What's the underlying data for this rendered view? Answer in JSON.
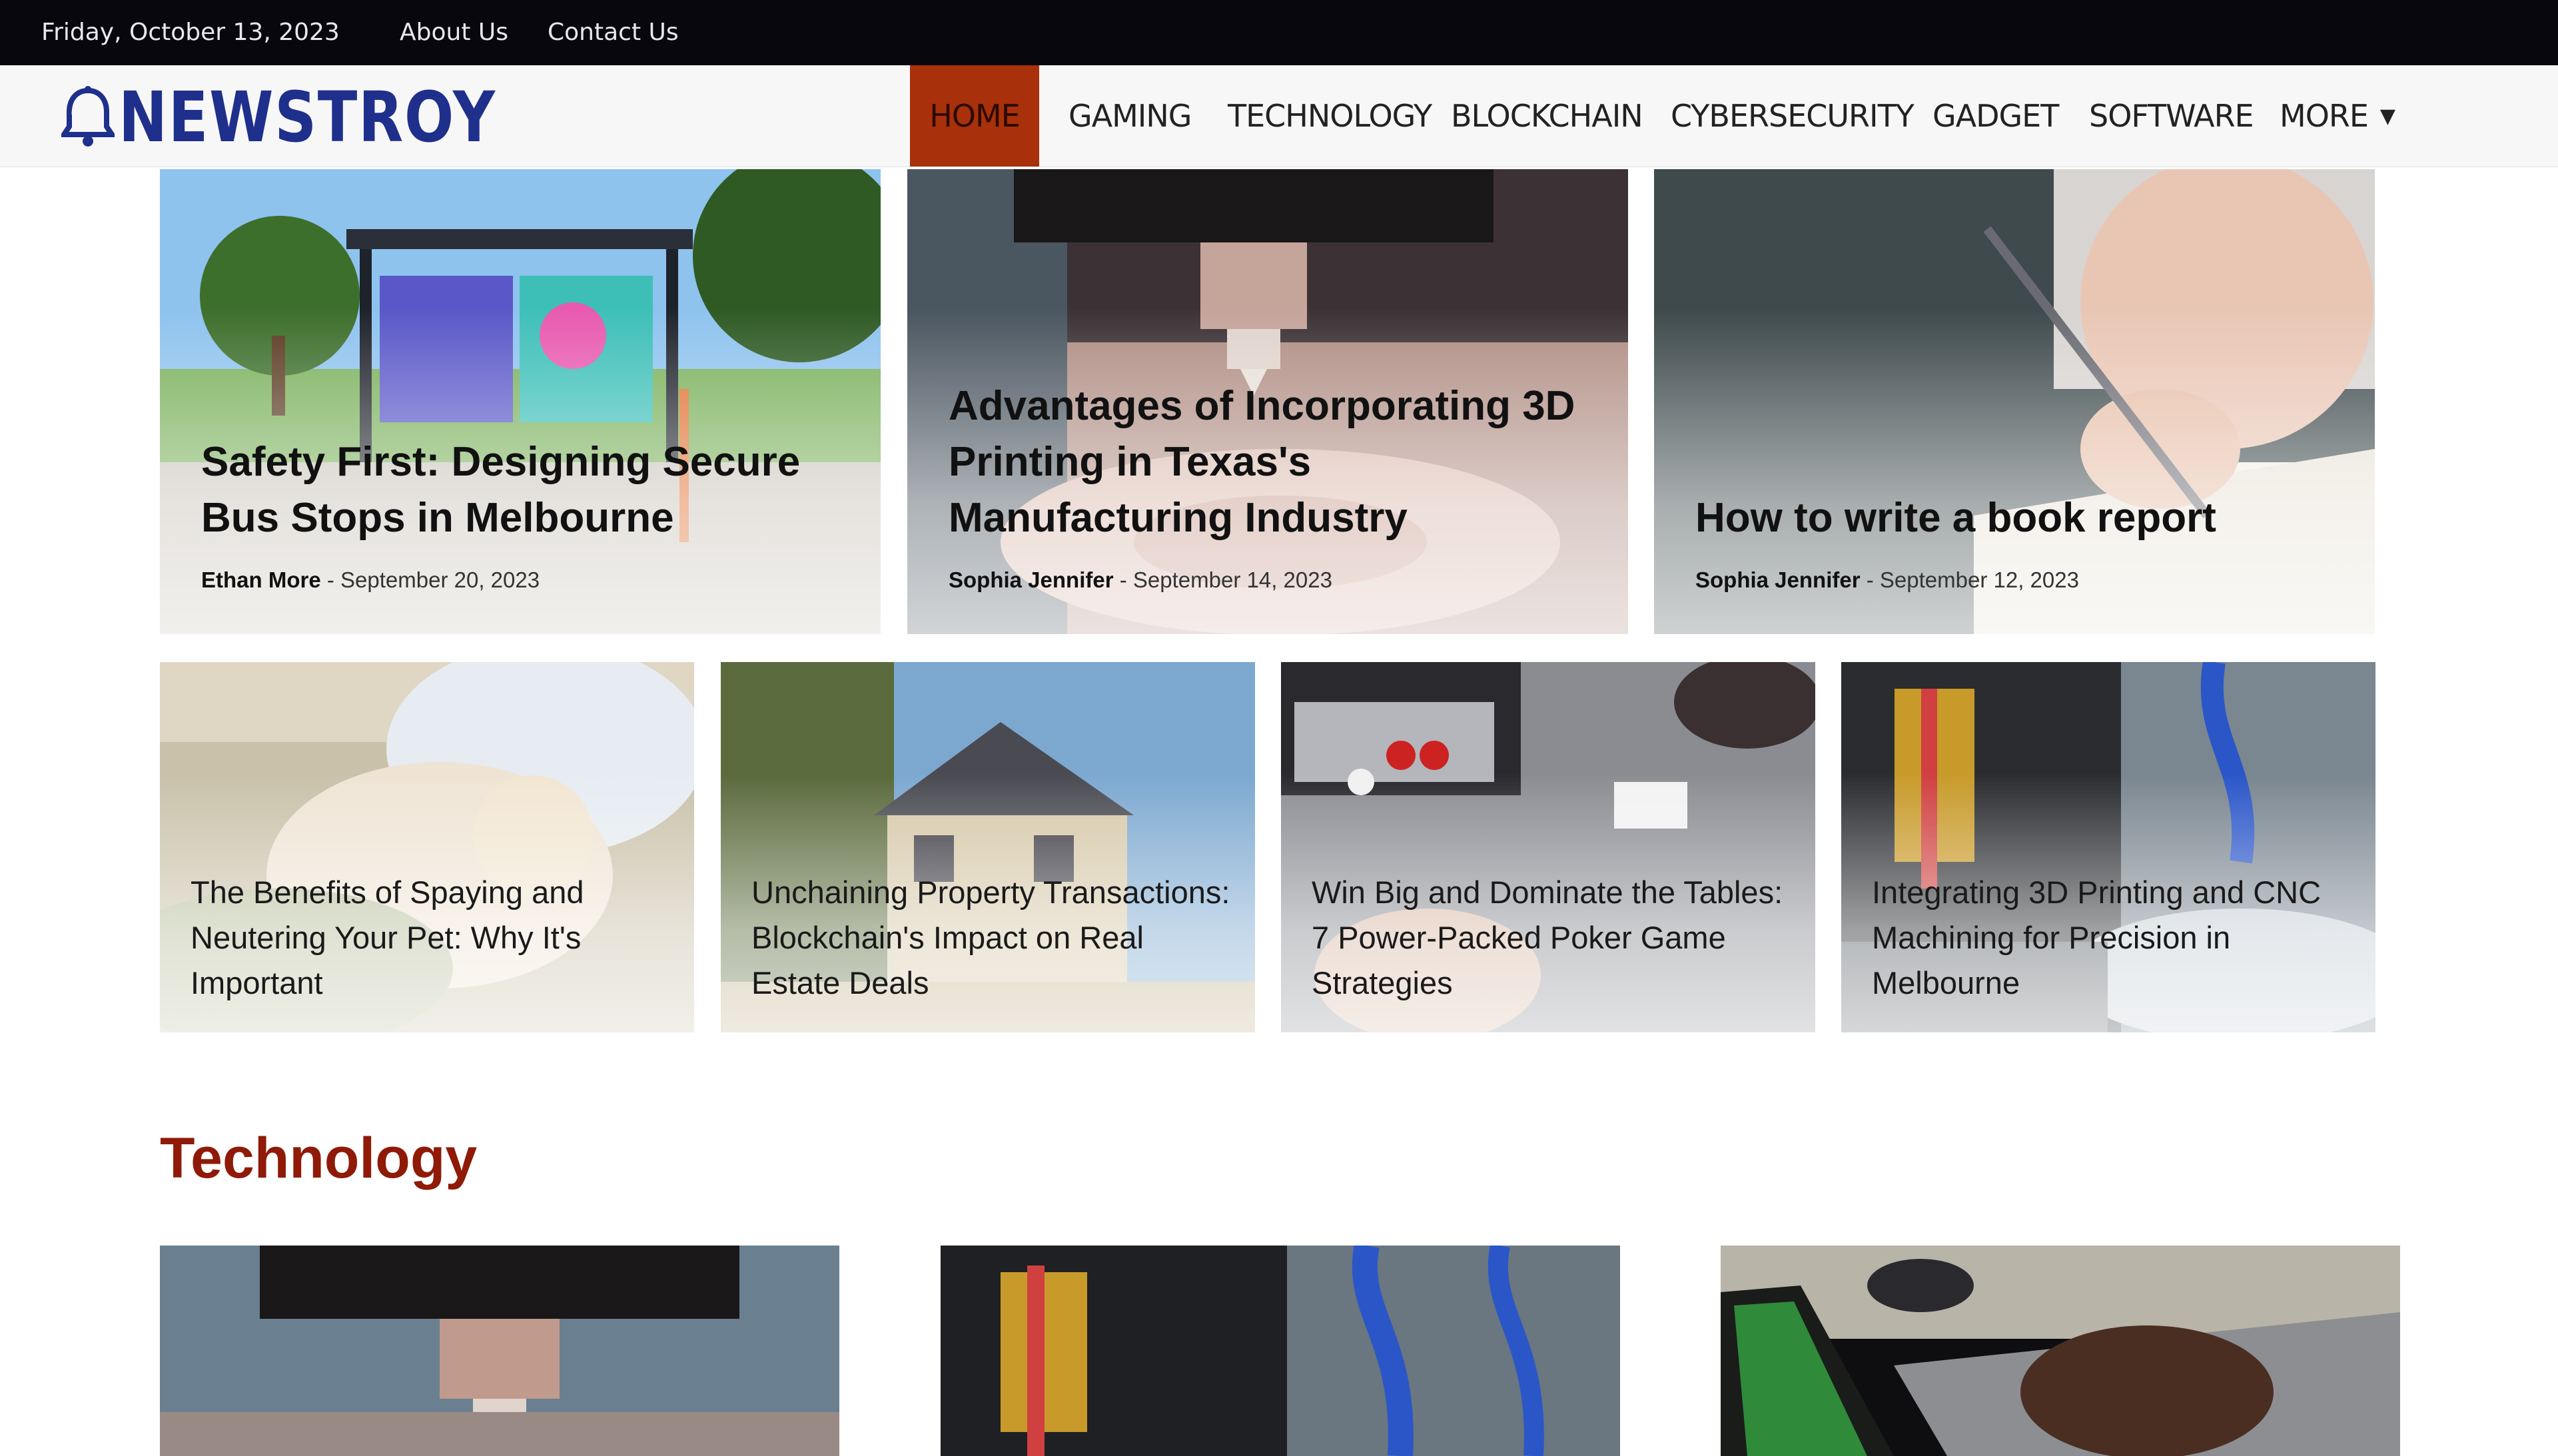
{
  "topbar": {
    "date": "Friday, October 13, 2023",
    "links": [
      "About Us",
      "Contact Us"
    ]
  },
  "brand": {
    "name": "NEWSTROY",
    "color": "#1f2f8c",
    "icon": "bell-icon"
  },
  "nav": {
    "items": [
      "HOME",
      "GAMING",
      "TECHNOLOGY",
      "BLOCKCHAIN",
      "CYBERSECURITY",
      "GADGET",
      "SOFTWARE",
      "MORE"
    ],
    "active": "HOME",
    "active_color": "#a8300a",
    "more_icon": "chevron-down-icon"
  },
  "featured": [
    {
      "title": "Safety First: Designing Secure Bus Stops in Melbourne",
      "author": "Ethan More",
      "date": "September 20, 2023"
    },
    {
      "title": "Advantages of Incorporating 3D Printing in Texas's Manufacturing Industry",
      "author": "Sophia Jennifer",
      "date": "September 14, 2023"
    },
    {
      "title": "How to write a book report",
      "author": "Sophia Jennifer",
      "date": "September 12, 2023"
    }
  ],
  "secondary": [
    {
      "title": "The Benefits of Spaying and Neutering Your Pet: Why It's Important"
    },
    {
      "title": "Unchaining Property Transactions: Blockchain's Impact on Real Estate Deals"
    },
    {
      "title": "Win Big and Dominate the Tables: 7 Power-Packed Poker Game Strategies"
    },
    {
      "title": "Integrating 3D Printing and CNC Machining for Precision in Melbourne"
    }
  ],
  "section": {
    "title": "Technology",
    "color": "#8f1a07"
  },
  "meta_separator": "-"
}
